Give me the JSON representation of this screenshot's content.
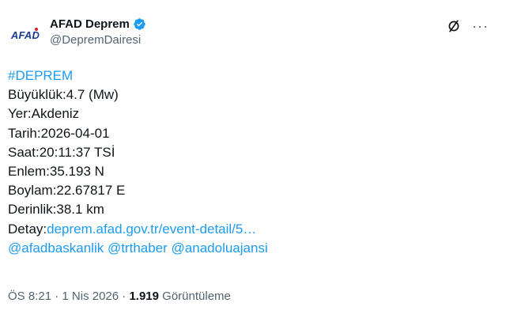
{
  "account": {
    "avatar_text": "AFAD",
    "display_name": "AFAD Deprem",
    "handle": "@DepremDairesi"
  },
  "tweet": {
    "hashtag": "#DEPREM",
    "lines": {
      "magnitude": "Büyüklük:4.7 (Mw)",
      "location": "Yer:Akdeniz",
      "date": "Tarih:2026-04-01",
      "time": "Saat:20:11:37 TSİ",
      "latitude": "Enlem:35.193 N",
      "longitude": "Boylam:22.67817 E",
      "depth": "Derinlik:38.1 km"
    },
    "detail_label": "Detay:",
    "detail_link": "deprem.afad.gov.tr/event-detail/5…",
    "mentions": {
      "m1": "@afadbaskanlik",
      "m2": "@trthaber",
      "m3": "@anadoluajansi"
    }
  },
  "meta": {
    "time": "ÖS 8:21",
    "separator": "·",
    "date": "1 Nis 2026",
    "views_count": "1.919",
    "views_label": "Görüntüleme"
  },
  "icons": {
    "verified": "verified-badge-icon",
    "grok": "grok-icon",
    "more": "more-icon"
  },
  "colors": {
    "link": "#1d9bf0",
    "text": "#0f1419",
    "muted": "#536471",
    "brand": "#1a3a8a"
  }
}
